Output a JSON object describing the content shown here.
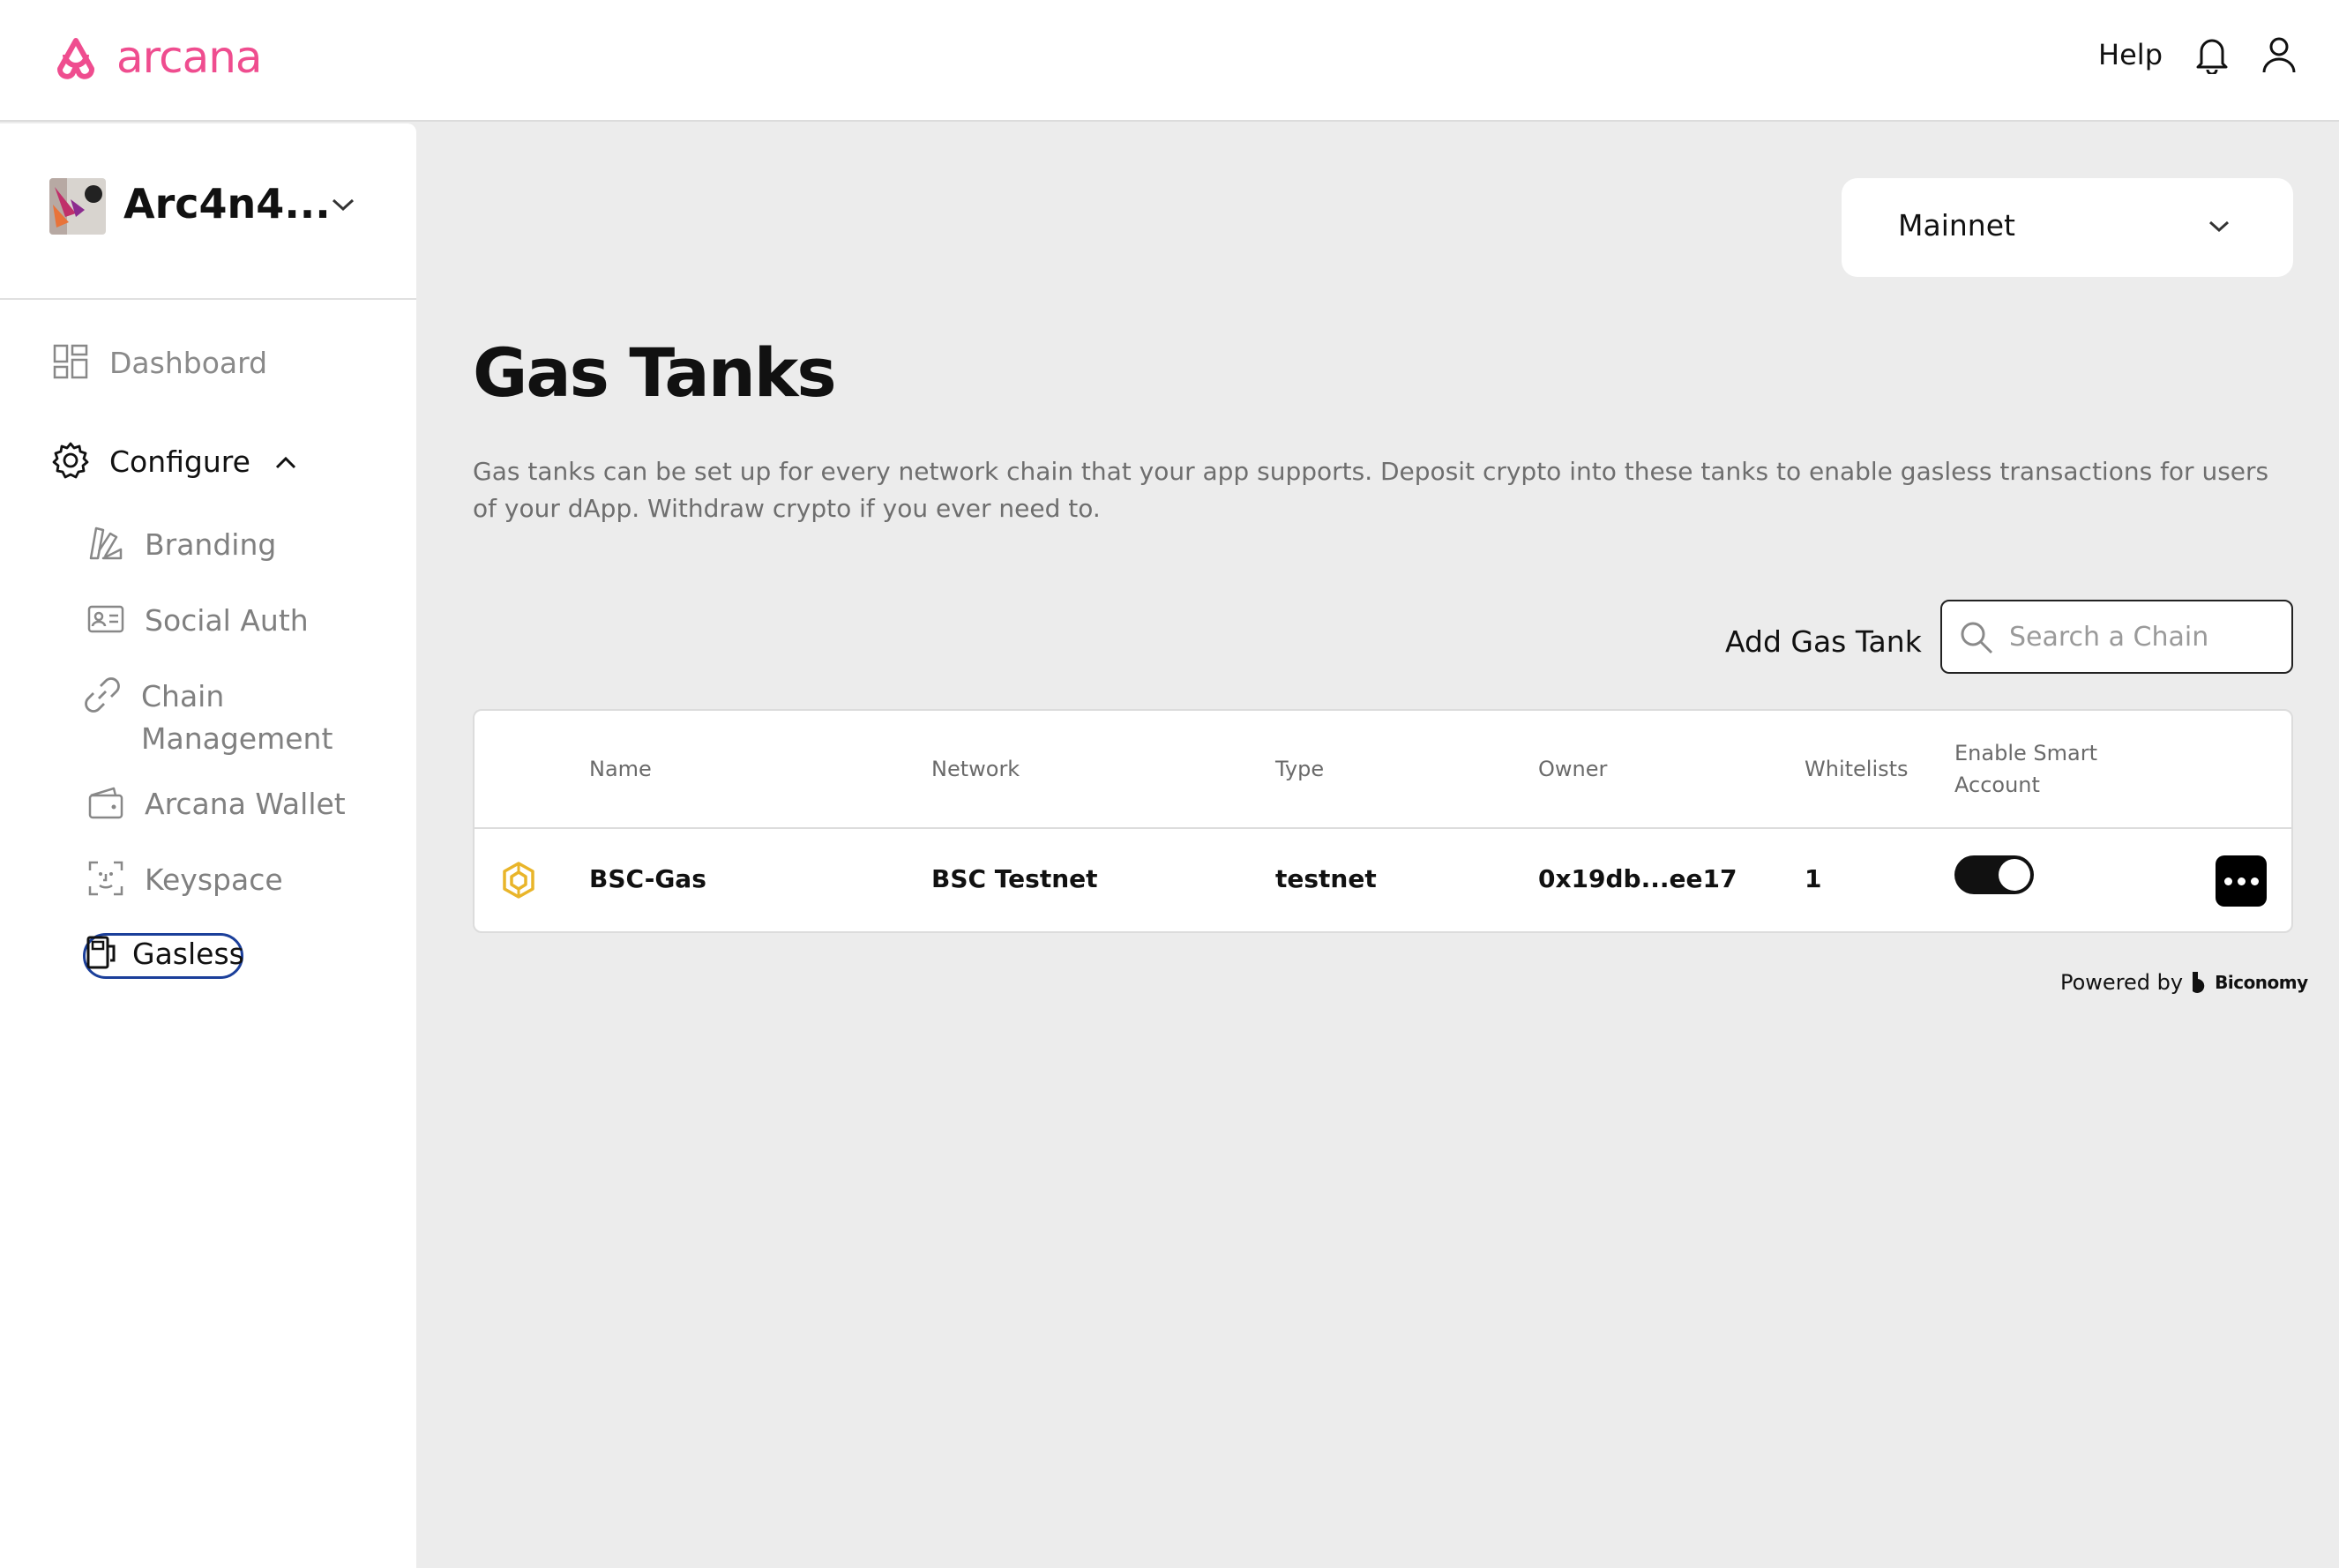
{
  "header": {
    "brand": "arcana",
    "help_label": "Help",
    "brand_color": "#ef4d8f",
    "icons": [
      "bell-icon",
      "user-icon"
    ]
  },
  "sidebar": {
    "app_name": "Arc4n4...",
    "items": [
      {
        "label": "Dashboard",
        "icon": "dashboard-icon"
      },
      {
        "label": "Configure",
        "icon": "gear-icon",
        "expanded": true
      },
      {
        "label": "Branding",
        "icon": "branding-icon"
      },
      {
        "label": "Social Auth",
        "icon": "id-card-icon"
      },
      {
        "label": "Chain Management",
        "icon": "link-icon"
      },
      {
        "label": "Arcana Wallet",
        "icon": "wallet-icon"
      },
      {
        "label": "Keyspace",
        "icon": "face-scan-icon"
      },
      {
        "label": "Gasless",
        "icon": "gas-pump-icon",
        "selected": true
      }
    ]
  },
  "main": {
    "network": "Mainnet",
    "title": "Gas Tanks",
    "description": "Gas tanks can be set up for every network chain that your app supports. Deposit crypto into these tanks to enable gasless transactions for users of your dApp. Withdraw crypto if you ever need to.",
    "add_tank_label": "Add Gas Tank",
    "search_placeholder": "Search a Chain",
    "table": {
      "columns": [
        "Name",
        "Network",
        "Type",
        "Owner",
        "Whitelists",
        "Enable Smart Account"
      ],
      "rows": [
        {
          "name": "BSC-Gas",
          "network": "BSC Testnet",
          "type": "testnet",
          "owner": "0x19db...ee17",
          "whitelists": "1",
          "smart_account_enabled": true,
          "icon": "bnb-icon"
        }
      ]
    },
    "powered_by": "Powered by",
    "powered_brand": "Biconomy"
  }
}
